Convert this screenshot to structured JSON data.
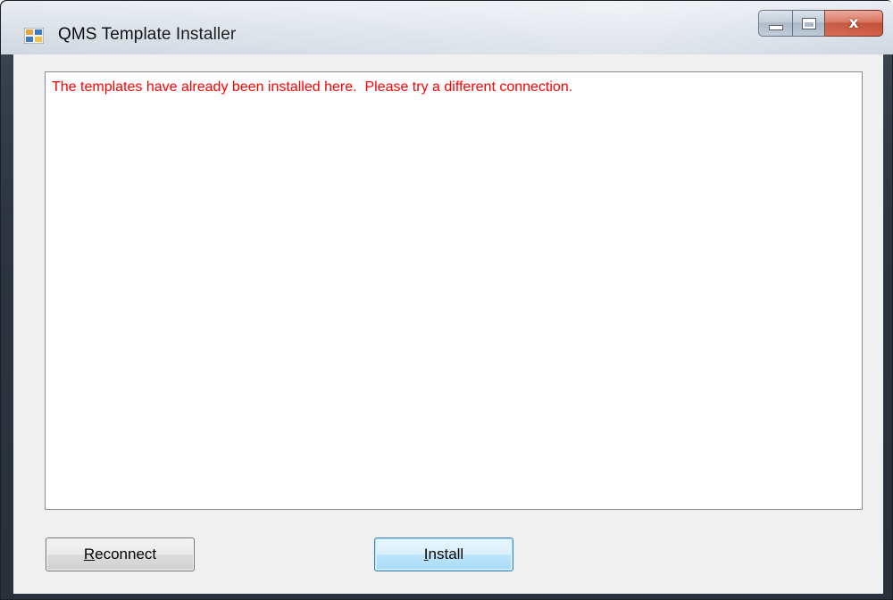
{
  "window": {
    "title": "QMS Template Installer",
    "icon": "application-icon"
  },
  "caption_buttons": {
    "minimize": "minimize-icon",
    "maximize": "maximize-icon",
    "close": "close-icon",
    "close_glyph": "x"
  },
  "log": {
    "message": "The templates have already been installed here.  Please try a different connection.",
    "message_color": "#ff0000"
  },
  "buttons": {
    "reconnect": {
      "mnemonic": "R",
      "rest": "econnect"
    },
    "install": {
      "mnemonic": "I",
      "rest": "nstall"
    }
  }
}
